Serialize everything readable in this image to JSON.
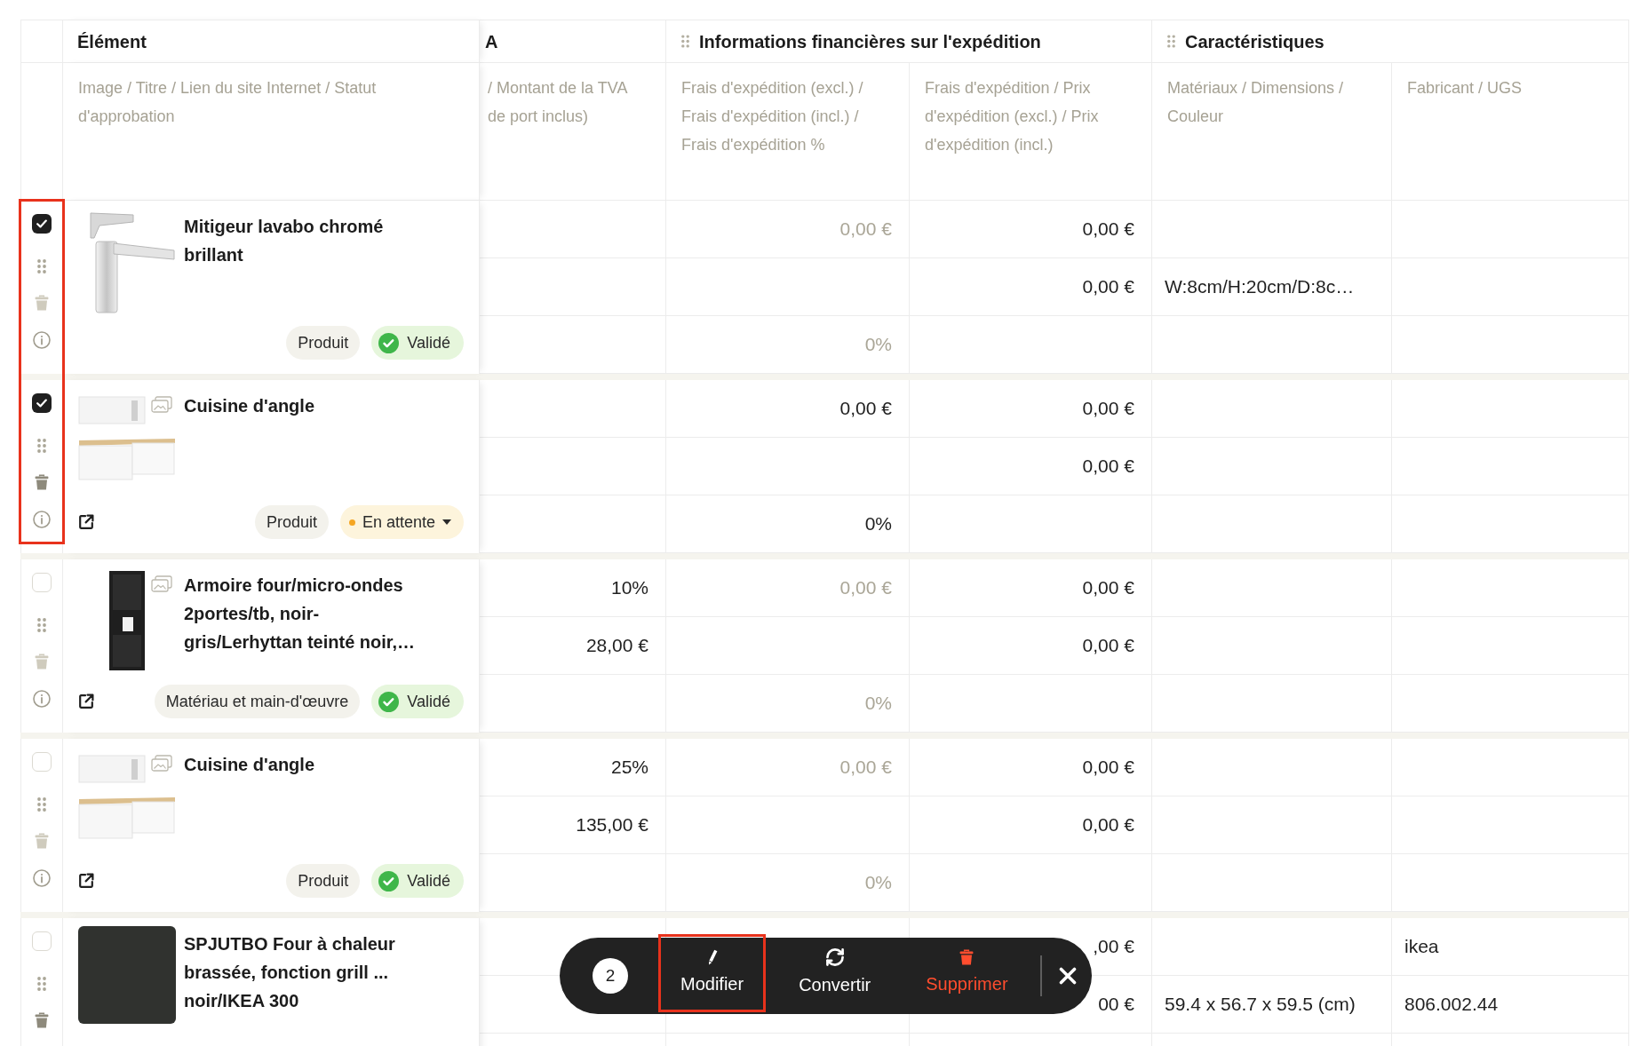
{
  "table": {
    "groups": [
      {
        "title": "Élément",
        "grip": false,
        "columns": [
          {
            "kind": "element",
            "subheader": "Image / Titre / Lien du site Internet / Statut d'approbation"
          }
        ]
      },
      {
        "title": "A",
        "grip": false,
        "columns": [
          {
            "kind": "amount",
            "subheader_lines": [
              "/ Montant de la TVA",
              "de port inclus)"
            ]
          }
        ]
      },
      {
        "title": "Informations financières sur l'expédition",
        "grip": true,
        "columns": [
          {
            "kind": "amount",
            "subheader": "Frais d'expédition (excl.) / Frais d'expédition (incl.) / Frais d'expédition %"
          },
          {
            "kind": "amount",
            "subheader": "Frais d'expédition / Prix d'expédition (excl.) / Prix d'expédition (incl.)"
          }
        ]
      },
      {
        "title": "Caractéristiques",
        "grip": true,
        "columns": [
          {
            "kind": "text",
            "subheader": "Matériaux / Dimensions / Couleur"
          },
          {
            "kind": "text",
            "subheader": "Fabricant / UGS"
          }
        ]
      }
    ],
    "rows": [
      {
        "selected": true,
        "highlighted": true,
        "delete_disabled": true,
        "image": {
          "kind": "faucet",
          "gallery": false
        },
        "link": false,
        "title": "Mitigeur lavabo chromé brillant",
        "badges": [
          {
            "kind": "type",
            "text": "Produit"
          },
          {
            "kind": "approved",
            "text": "Validé"
          }
        ],
        "values": {
          "shipping_fee_excl": {
            "text": "0,00 €",
            "muted": true
          },
          "shipping_fee_percent": {
            "text": "0%",
            "muted": true
          },
          "shipping_fee": {
            "text": "0,00 €",
            "muted": false
          },
          "shipping_price_excl": {
            "text": "0,00 €",
            "muted": false
          },
          "dimensions": {
            "text": "W:8cm/H:20cm/D:8c…",
            "muted": false
          }
        }
      },
      {
        "selected": true,
        "highlighted": true,
        "delete_disabled": false,
        "image": {
          "kind": "kitchen",
          "gallery": true
        },
        "link": true,
        "title": "Cuisine d'angle",
        "badges": [
          {
            "kind": "type",
            "text": "Produit"
          },
          {
            "kind": "pending",
            "text": "En attente"
          }
        ],
        "values": {
          "shipping_fee_excl": {
            "text": "0,00 €",
            "muted": false
          },
          "shipping_fee_percent": {
            "text": "0%",
            "muted": false
          },
          "shipping_fee": {
            "text": "0,00 €",
            "muted": false
          },
          "shipping_price_excl": {
            "text": "0,00 €",
            "muted": false
          }
        }
      },
      {
        "selected": false,
        "highlighted": false,
        "delete_disabled": true,
        "image": {
          "kind": "cabinet",
          "gallery": true
        },
        "link": true,
        "title": "Armoire four/micro-ondes 2portes/tb, noir-gris/Lerhyttan teinté noir,…",
        "badges": [
          {
            "kind": "type",
            "text": "Matériau et main-d'œuvre"
          },
          {
            "kind": "approved",
            "text": "Validé"
          }
        ],
        "values": {
          "vat_rate": {
            "text": "10%",
            "muted": false
          },
          "vat_amount": {
            "text": "28,00 €",
            "muted": false
          },
          "shipping_fee_excl": {
            "text": "0,00 €",
            "muted": true
          },
          "shipping_fee_percent": {
            "text": "0%",
            "muted": true
          },
          "shipping_fee": {
            "text": "0,00 €",
            "muted": false
          },
          "shipping_price_excl": {
            "text": "0,00 €",
            "muted": false
          }
        }
      },
      {
        "selected": false,
        "highlighted": false,
        "delete_disabled": true,
        "image": {
          "kind": "kitchen",
          "gallery": true
        },
        "link": true,
        "title": "Cuisine d'angle",
        "badges": [
          {
            "kind": "type",
            "text": "Produit"
          },
          {
            "kind": "approved",
            "text": "Validé"
          }
        ],
        "values": {
          "vat_rate": {
            "text": "25%",
            "muted": false
          },
          "vat_amount": {
            "text": "135,00 €",
            "muted": false
          },
          "shipping_fee_excl": {
            "text": "0,00 €",
            "muted": true
          },
          "shipping_fee_percent": {
            "text": "0%",
            "muted": true
          },
          "shipping_fee": {
            "text": "0,00 €",
            "muted": false
          },
          "shipping_price_excl": {
            "text": "0,00 €",
            "muted": false
          }
        }
      },
      {
        "selected": false,
        "highlighted": false,
        "delete_disabled": false,
        "image": {
          "kind": "photo",
          "gallery": false
        },
        "link": false,
        "title": "SPJUTBO Four à chaleur brassée, fonction grill ... noir/IKEA 300",
        "values": {
          "shipping_fee": {
            "text": ",00 €",
            "muted": false
          },
          "shipping_price_excl": {
            "text": "00 €",
            "muted": false
          },
          "dimensions": {
            "text": "59.4 x 56.7 x 59.5 (cm)",
            "muted": false
          },
          "manufacturer": {
            "text": "ikea",
            "muted": false
          },
          "sku": {
            "text": "806.002.44",
            "muted": false
          }
        }
      }
    ]
  },
  "bulk_actions": {
    "count": "2",
    "actions": [
      {
        "kind": "edit",
        "label": "Modifier",
        "danger": false,
        "highlighted": true
      },
      {
        "kind": "convert",
        "label": "Convertir",
        "danger": false,
        "highlighted": false
      },
      {
        "kind": "delete",
        "label": "Supprimer",
        "danger": true,
        "highlighted": false
      }
    ]
  }
}
